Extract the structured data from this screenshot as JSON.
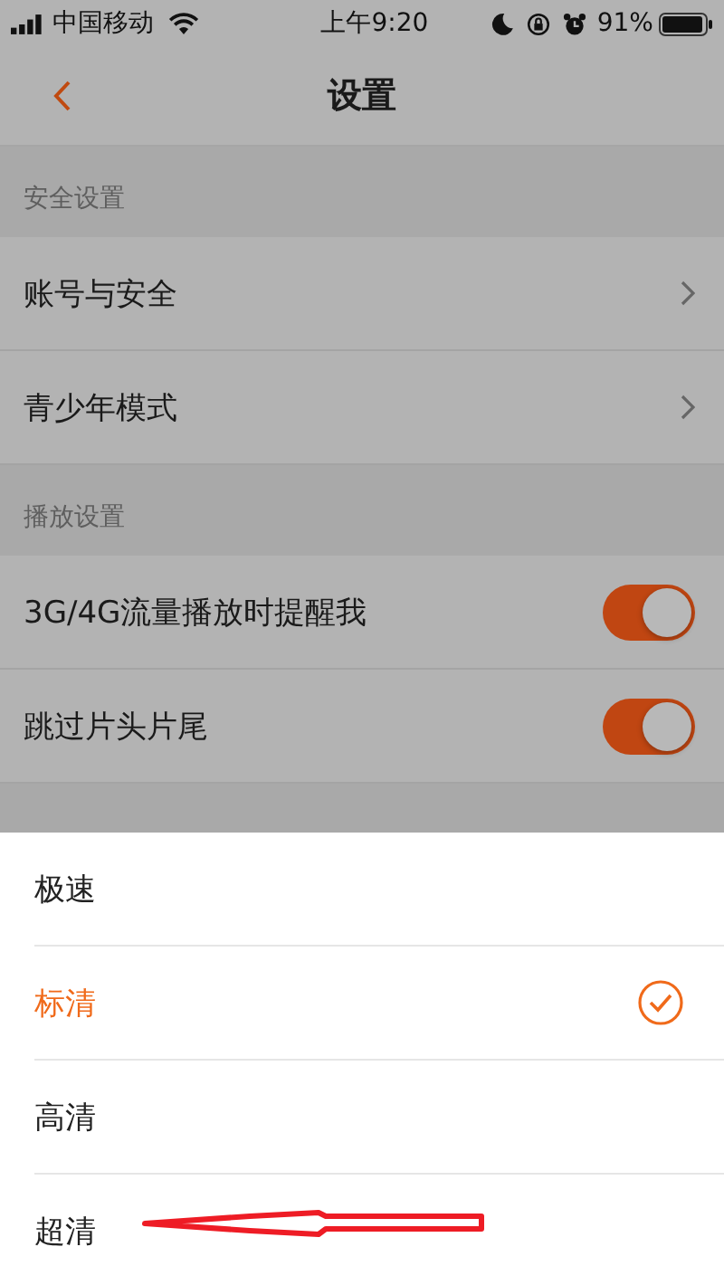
{
  "status_bar": {
    "carrier": "中国移动",
    "time": "上午9:20",
    "battery": "91%"
  },
  "nav": {
    "title": "设置"
  },
  "sections": [
    {
      "title": "安全设置",
      "items": [
        {
          "label": "账号与安全",
          "kind": "link"
        },
        {
          "label": "青少年模式",
          "kind": "link"
        }
      ]
    },
    {
      "title": "播放设置",
      "items": [
        {
          "label": "3G/4G流量播放时提醒我",
          "kind": "toggle",
          "on": true
        },
        {
          "label": "跳过片头片尾",
          "kind": "toggle",
          "on": true
        }
      ]
    }
  ],
  "sheet": {
    "options": [
      {
        "label": "极速",
        "selected": false
      },
      {
        "label": "标清",
        "selected": true
      },
      {
        "label": "高清",
        "selected": false
      },
      {
        "label": "超清",
        "selected": false
      }
    ]
  }
}
